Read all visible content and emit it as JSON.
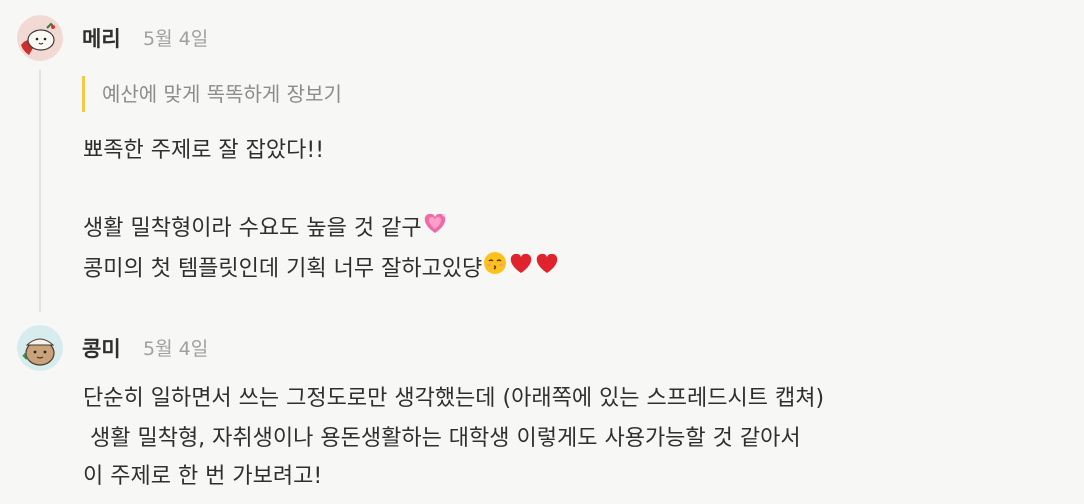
{
  "comments": [
    {
      "author": "메리",
      "date": "5월 4일",
      "quote": "예산에 맞게 똑똑하게 장보기",
      "lines": [
        "뾰족한 주제로 잘 잡았다!!",
        "생활 밀착형이라 수요도 높을 것 같구",
        "콩미의 첫 템플릿인데 기획 너무 잘하고있댱"
      ]
    },
    {
      "author": "콩미",
      "date": "5월 4일",
      "lines": [
        "단순히 일하면서 쓰는 그정도로만 생각했는데 (아래쪽에 있는 스프레드시트 캡쳐)",
        " 생활 밀착형, 자취생이나 용돈생활하는 대학생 이렇게도 사용가능할 것 같아서",
        "이 주제로 한 번 가보려고!"
      ]
    }
  ],
  "emoji": {
    "heart_pink": "sparkling-heart-icon",
    "kiss": "kissing-face-icon",
    "heart_red": "red-heart-icon"
  },
  "colors": {
    "background": "#f7f7f5",
    "quote_bar": "#f5c94a",
    "text": "#2f2f2f",
    "muted": "#a0a09e"
  }
}
